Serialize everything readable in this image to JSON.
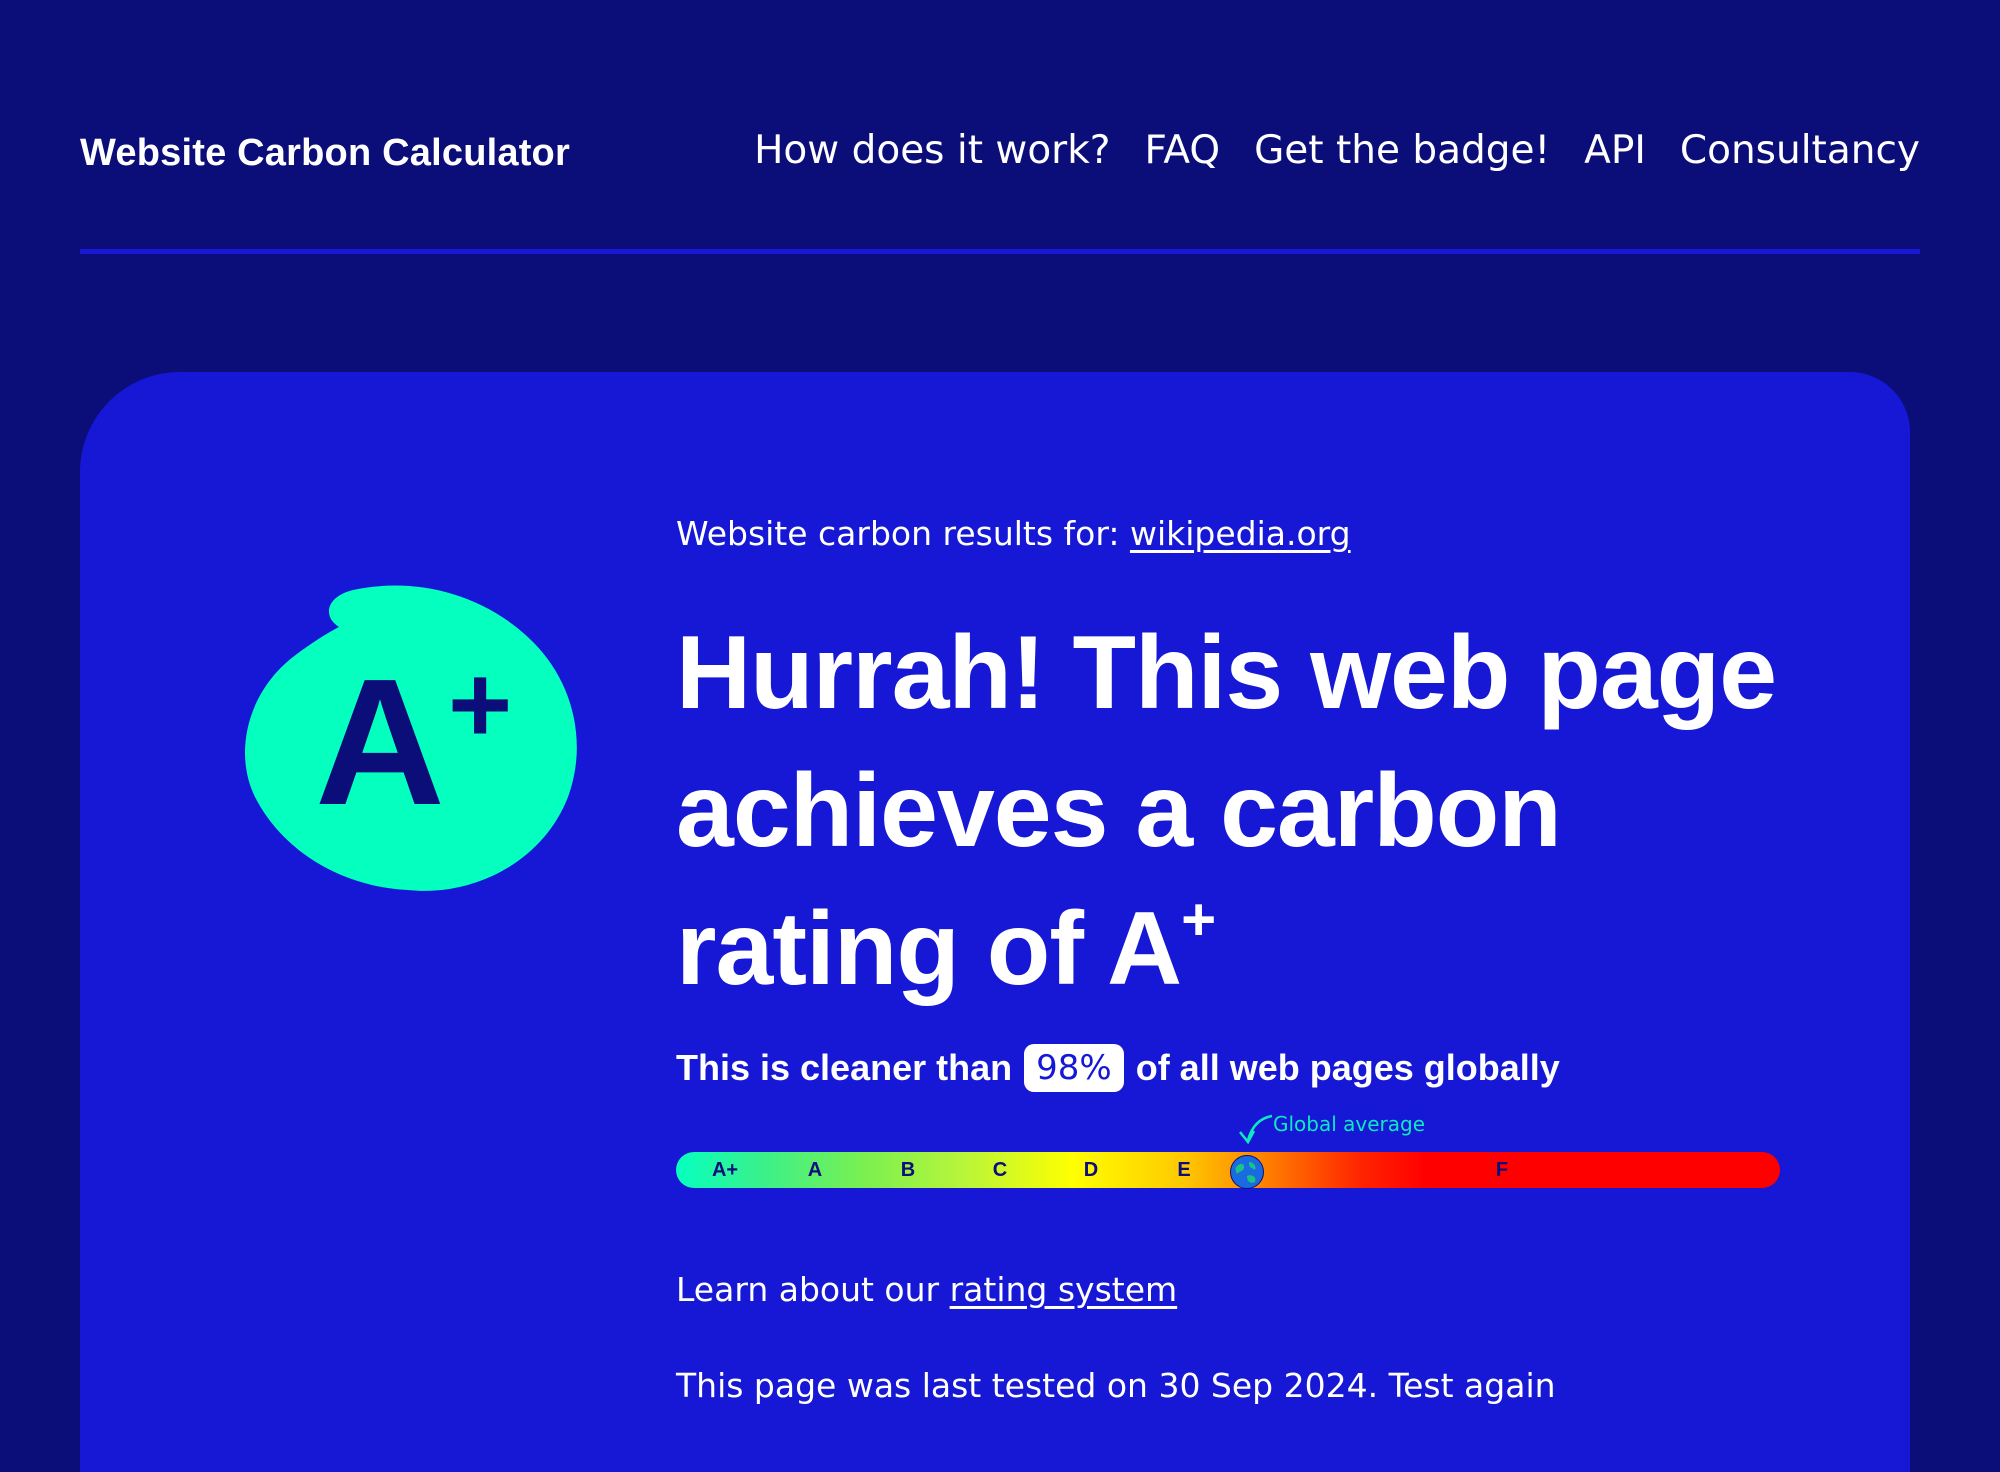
{
  "header": {
    "brand": "Website Carbon Calculator",
    "nav": [
      "How does it work?",
      "FAQ",
      "Get the badge!",
      "API",
      "Consultancy"
    ]
  },
  "badge": {
    "rating_main": "A",
    "rating_sup": "+"
  },
  "results": {
    "label": "Website carbon results for: ",
    "site": "wikipedia.org"
  },
  "headline": {
    "text": "Hurrah! This web page achieves a carbon rating of A",
    "sup": "+"
  },
  "cleaner": {
    "before": "This is cleaner than",
    "percent": "98%",
    "after": "of all web pages globally"
  },
  "scale": {
    "global_average_label": "Global average",
    "grades": [
      "A+",
      "A",
      "B",
      "C",
      "D",
      "E",
      "F"
    ]
  },
  "learn": {
    "before": "Learn about our ",
    "link": "rating system"
  },
  "partial_line": "This page was last tested on 30 Sep 2024. Test again",
  "colors": {
    "background": "#0b0d78",
    "panel": "#1618d6",
    "badge": "#05ffbf",
    "accent": "#0fe8c0"
  }
}
